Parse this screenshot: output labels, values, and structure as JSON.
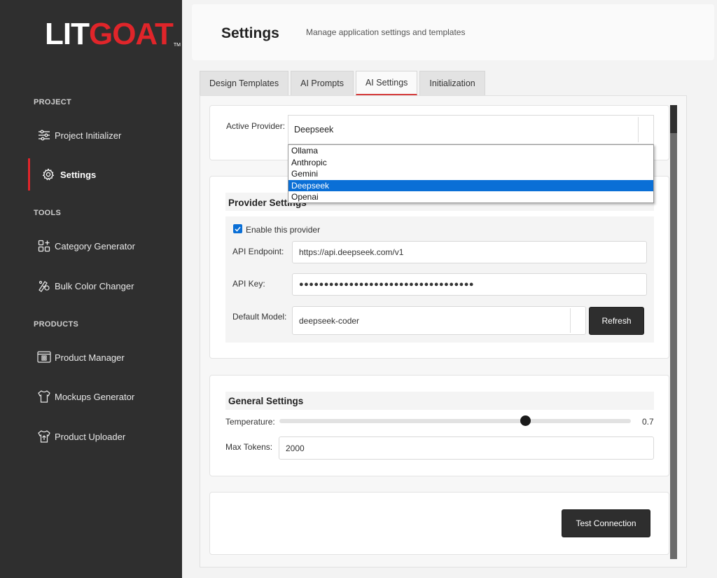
{
  "sidebar": {
    "logo": {
      "part1": "LIT",
      "part2": "GOAT",
      "tm": "TM"
    },
    "sections": [
      {
        "label": "PROJECT"
      },
      {
        "label": "TOOLS"
      },
      {
        "label": "PRODUCTS"
      }
    ],
    "items": [
      {
        "label": "Project Initializer",
        "icon": "sliders-icon"
      },
      {
        "label": "Settings",
        "icon": "gear-icon",
        "active": true
      },
      {
        "label": "Category Generator",
        "icon": "grid-plus-icon"
      },
      {
        "label": "Bulk Color Changer",
        "icon": "palette-icon"
      },
      {
        "label": "Product Manager",
        "icon": "product-frame-icon"
      },
      {
        "label": "Mockups Generator",
        "icon": "tshirt-icon"
      },
      {
        "label": "Product Uploader",
        "icon": "tshirt-upload-icon"
      }
    ]
  },
  "header": {
    "title": "Settings",
    "subtitle": "Manage application settings and templates"
  },
  "tabs": [
    {
      "label": "Design Templates"
    },
    {
      "label": "AI Prompts"
    },
    {
      "label": "AI Settings",
      "active": true
    },
    {
      "label": "Initialization"
    }
  ],
  "active_provider": {
    "label": "Active Provider:",
    "value": "Deepseek",
    "options": [
      "Ollama",
      "Anthropic",
      "Gemini",
      "Deepseek",
      "Openai"
    ],
    "selected_index": 3
  },
  "provider_settings": {
    "heading": "Provider Settings",
    "enable_label": "Enable this provider",
    "enabled": true,
    "endpoint_label": "API Endpoint:",
    "endpoint_value": "https://api.deepseek.com/v1",
    "key_label": "API Key:",
    "key_value": "●●●●●●●●●●●●●●●●●●●●●●●●●●●●●●●●●●●",
    "model_label": "Default Model:",
    "model_value": "deepseek-coder",
    "refresh_label": "Refresh"
  },
  "general_settings": {
    "heading": "General Settings",
    "temperature_label": "Temperature:",
    "temperature_value": "0.7",
    "temperature_fraction": 0.7,
    "max_tokens_label": "Max Tokens:",
    "max_tokens_value": "2000"
  },
  "actions": {
    "test_connection_label": "Test Connection"
  },
  "colors": {
    "sidebar_bg": "#2f2f2f",
    "brand_red": "#e0252a",
    "accent_blue": "#0a6fd6",
    "button_dark": "#2e2e2e"
  }
}
